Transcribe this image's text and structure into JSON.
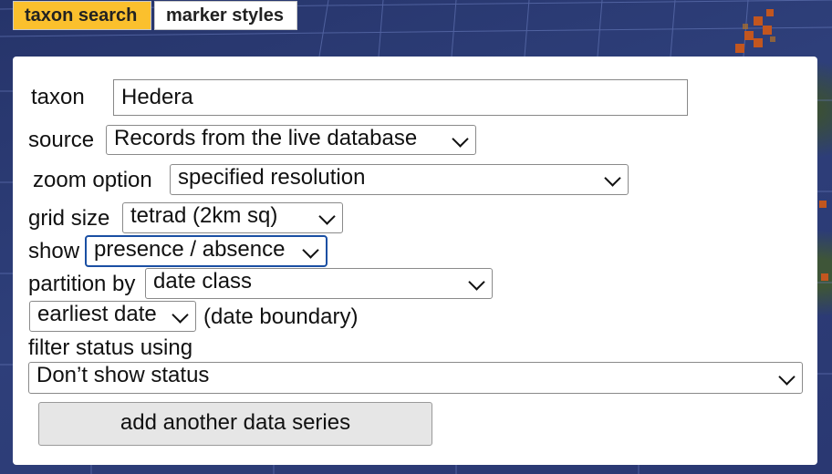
{
  "tabs": [
    {
      "label": "taxon search"
    },
    {
      "label": "marker styles"
    }
  ],
  "form": {
    "taxon": {
      "label": "taxon",
      "value": "Hedera"
    },
    "source": {
      "label": "source",
      "value": "Records from the live database"
    },
    "zoom_option": {
      "label": "zoom option",
      "value": "specified resolution"
    },
    "grid_size": {
      "label": "grid size",
      "value": "tetrad (2km sq)"
    },
    "show": {
      "label": "show",
      "value": "presence / absence"
    },
    "partition_by": {
      "label": "partition by",
      "value": "date class"
    },
    "date_boundary": {
      "value": "earliest date",
      "label": "(date boundary)"
    },
    "filter_status": {
      "label": "filter status using",
      "value": "Don’t show status"
    },
    "add_series_button": "add another data series"
  },
  "colors": {
    "tab_active": "#fbc02d",
    "focus_border": "#1a4fa3",
    "map_sea": "#2b3a6e"
  },
  "icons": [
    "chevron-down-icon"
  ]
}
